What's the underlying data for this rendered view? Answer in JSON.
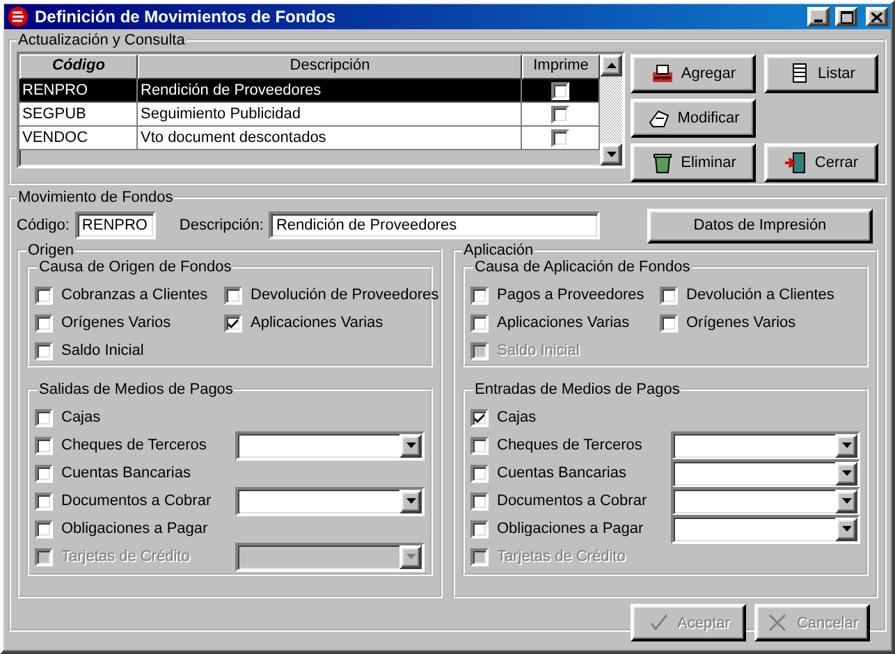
{
  "window": {
    "title": "Definición de Movimientos de Fondos"
  },
  "consulta": {
    "title": "Actualización y Consulta",
    "columns": [
      "Código",
      "Descripción",
      "Imprime"
    ],
    "rows": [
      {
        "codigo": "RENPRO",
        "descripcion": "Rendición de Proveedores",
        "imprime": false,
        "selected": true
      },
      {
        "codigo": "SEGPUB",
        "descripcion": "Seguimiento Publicidad",
        "imprime": false,
        "selected": false
      },
      {
        "codigo": "VENDOC",
        "descripcion": "Vto document descontados",
        "imprime": false,
        "selected": false
      }
    ]
  },
  "actions": [
    {
      "label": "Agregar",
      "kind": "add"
    },
    {
      "label": "Listar",
      "kind": "list"
    },
    {
      "label": "Modificar",
      "kind": "edit"
    },
    {
      "label": "Eliminar",
      "kind": "delete"
    },
    {
      "label": "Cerrar",
      "kind": "close"
    }
  ],
  "movimiento": {
    "title": "Movimiento de Fondos",
    "codigo_label": "Código:",
    "codigo": "RENPRO",
    "descripcion_label": "Descripción:",
    "descripcion": "Rendición de Proveedores",
    "print_button": "Datos de Impresión"
  },
  "panels": [
    {
      "title": "Origen",
      "groups": [
        {
          "title": "Causa de Origen de Fondos",
          "kind": "grid",
          "items": [
            {
              "label": "Cobranzas a Clientes",
              "checked": false,
              "disabled": false,
              "kind": "check"
            },
            {
              "label": "Devolución de Proveedores",
              "checked": false,
              "disabled": false,
              "kind": "check"
            },
            {
              "label": "Orígenes Varios",
              "checked": false,
              "disabled": false,
              "kind": "check"
            },
            {
              "label": "Aplicaciones Varias",
              "checked": true,
              "disabled": false,
              "kind": "check"
            },
            {
              "label": "Saldo Inicial",
              "checked": false,
              "disabled": false,
              "kind": "check"
            }
          ]
        },
        {
          "title": "Salidas de Medios de Pagos",
          "kind": "list",
          "items": [
            {
              "label": "Cajas",
              "checked": false,
              "disabled": false,
              "kind": "check"
            },
            {
              "label": "Cheques de Terceros",
              "checked": false,
              "disabled": false,
              "kind": "combo"
            },
            {
              "label": "Cuentas Bancarias",
              "checked": false,
              "disabled": false,
              "kind": "check"
            },
            {
              "label": "Documentos a Cobrar",
              "checked": false,
              "disabled": false,
              "kind": "combo"
            },
            {
              "label": "Obligaciones a Pagar",
              "checked": false,
              "disabled": false,
              "kind": "check"
            },
            {
              "label": "Tarjetas de Crédito",
              "checked": false,
              "disabled": true,
              "kind": "combo"
            }
          ]
        }
      ]
    },
    {
      "title": "Aplicación",
      "groups": [
        {
          "title": "Causa de Aplicación de Fondos",
          "kind": "grid",
          "items": [
            {
              "label": "Pagos a Proveedores",
              "checked": false,
              "disabled": false,
              "kind": "check"
            },
            {
              "label": "Devolución a Clientes",
              "checked": false,
              "disabled": false,
              "kind": "check"
            },
            {
              "label": "Aplicaciones Varias",
              "checked": false,
              "disabled": false,
              "kind": "check"
            },
            {
              "label": "Orígenes Varios",
              "checked": false,
              "disabled": false,
              "kind": "check"
            },
            {
              "label": "Saldo Inicial",
              "checked": false,
              "disabled": true,
              "kind": "check"
            }
          ]
        },
        {
          "title": "Entradas de Medios de Pagos",
          "kind": "list",
          "items": [
            {
              "label": "Cajas",
              "checked": true,
              "disabled": false,
              "kind": "check"
            },
            {
              "label": "Cheques de Terceros",
              "checked": false,
              "disabled": false,
              "kind": "combo"
            },
            {
              "label": "Cuentas Bancarias",
              "checked": false,
              "disabled": false,
              "kind": "combo"
            },
            {
              "label": "Documentos a Cobrar",
              "checked": false,
              "disabled": false,
              "kind": "combo"
            },
            {
              "label": "Obligaciones a Pagar",
              "checked": false,
              "disabled": false,
              "kind": "combo"
            },
            {
              "label": "Tarjetas de Crédito",
              "checked": false,
              "disabled": true,
              "kind": "check"
            }
          ]
        }
      ]
    }
  ],
  "footer_buttons": [
    {
      "label": "Aceptar",
      "kind": "accept",
      "disabled": true
    },
    {
      "label": "Cancelar",
      "kind": "cancel",
      "disabled": true
    }
  ]
}
